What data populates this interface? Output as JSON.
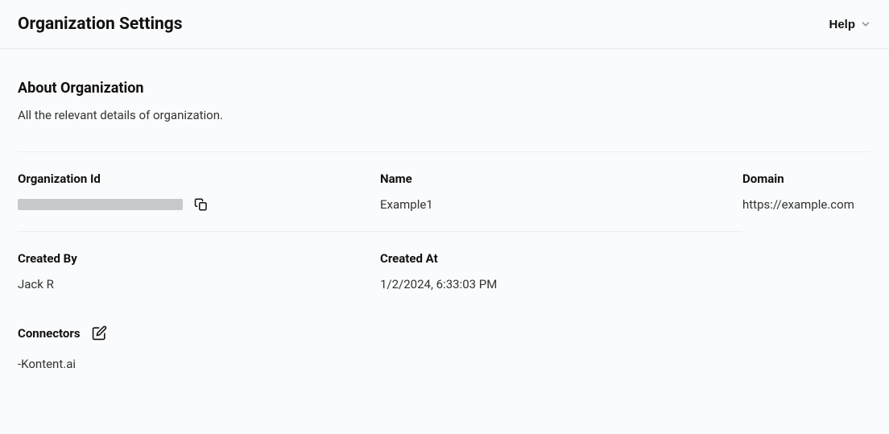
{
  "header": {
    "title": "Organization Settings",
    "help_label": "Help"
  },
  "about": {
    "title": "About Organization",
    "description": "All the relevant details of organization."
  },
  "fields": {
    "org_id_label": "Organization Id",
    "name_label": "Name",
    "name_value": "Example1",
    "domain_label": "Domain",
    "domain_value": "https://example.com",
    "created_by_label": "Created By",
    "created_by_value": "Jack R",
    "created_at_label": "Created At",
    "created_at_value": "1/2/2024, 6:33:03 PM"
  },
  "connectors": {
    "label": "Connectors",
    "items": [
      "-Kontent.ai"
    ]
  }
}
